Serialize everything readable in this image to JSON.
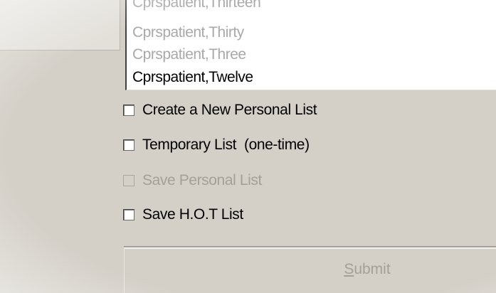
{
  "patient_list": {
    "items": [
      "Cprspatient,Thirteen",
      "Cprspatient,Thirty",
      "Cprspatient,Three",
      "Cprspatient,Twelve"
    ]
  },
  "options": {
    "create_new": "Create a New Personal List",
    "temporary": "Temporary List  (one-time)",
    "save_personal": "Save Personal List",
    "save_hot": "Save H.O.T List"
  },
  "submit": {
    "label_first": "S",
    "label_rest": "ubmit"
  }
}
